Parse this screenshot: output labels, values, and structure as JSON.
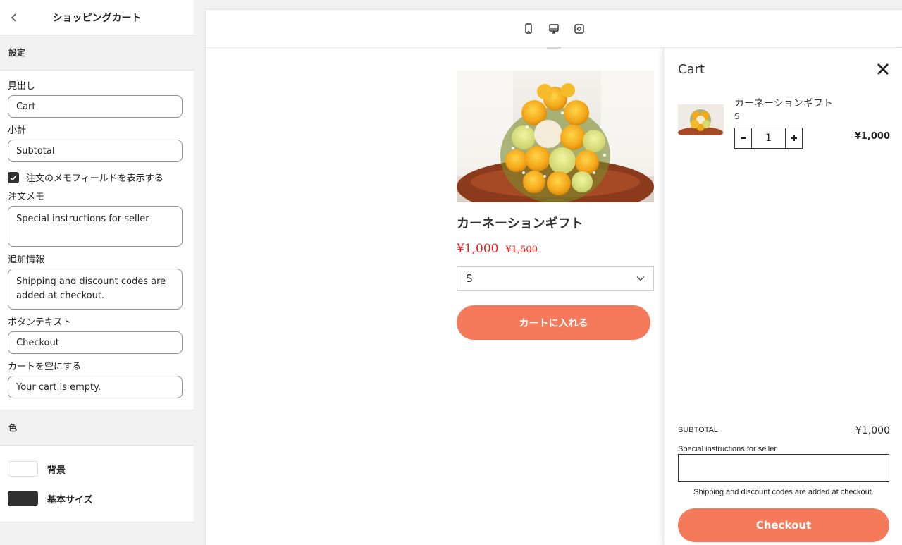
{
  "sidebar": {
    "title": "ショッピングカート",
    "settings_section": "設定",
    "fields": {
      "heading_label": "見出し",
      "heading_value": "Cart",
      "subtotal_label": "小計",
      "subtotal_value": "Subtotal",
      "show_note_label": "注文のメモフィールドを表示する",
      "note_label": "注文メモ",
      "note_value": "Special instructions for seller",
      "info_label": "追加情報",
      "info_value": "Shipping and discount codes are added at checkout.",
      "button_label": "ボタンテキスト",
      "button_value": "Checkout",
      "empty_label": "カートを空にする",
      "empty_value": "Your cart is empty."
    },
    "colors_section": "色",
    "colors": [
      {
        "label": "背景",
        "value": "#ffffff"
      },
      {
        "label": "基本サイズ",
        "value": "#303030"
      }
    ]
  },
  "toolbar": {
    "icons": [
      "mobile-icon",
      "desktop-icon",
      "fullscreen-icon"
    ],
    "active": "desktop-icon"
  },
  "product": {
    "title": "カーネーションギフト",
    "price": "¥1,000",
    "compare_price": "¥1,500",
    "variant": "S",
    "add_to_cart": "カートに入れる"
  },
  "cart": {
    "title": "Cart",
    "item": {
      "name": "カーネーションギフト",
      "variant": "S",
      "quantity": "1",
      "price": "¥1,000"
    },
    "subtotal_label": "SUBTOTAL",
    "subtotal_value": "¥1,000",
    "note_label": "Special instructions for seller",
    "info": "Shipping and discount codes are added at checkout.",
    "checkout": "Checkout"
  },
  "theme": {
    "accent": "#f47a5b",
    "sale_red": "#e11d1d"
  }
}
